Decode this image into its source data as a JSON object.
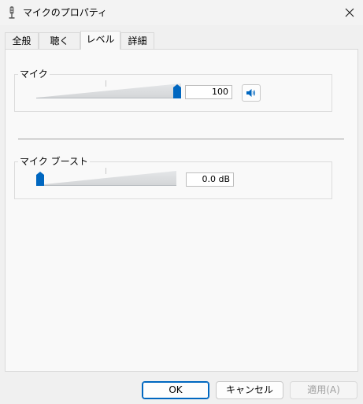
{
  "window": {
    "title": "マイクのプロパティ"
  },
  "tabs": [
    {
      "label": "全般",
      "active": false
    },
    {
      "label": "聴く",
      "active": false
    },
    {
      "label": "レベル",
      "active": true
    },
    {
      "label": "詳細",
      "active": false
    }
  ],
  "microphone": {
    "label": "マイク",
    "value": "100",
    "level_percent": 100,
    "mute_icon": "speaker-icon"
  },
  "boost": {
    "label": "マイク ブースト",
    "value": "0.0 dB",
    "level_percent": 0
  },
  "buttons": {
    "ok": "OK",
    "cancel": "キャンセル",
    "apply": "適用(A)"
  },
  "colors": {
    "accent": "#0067c0"
  }
}
